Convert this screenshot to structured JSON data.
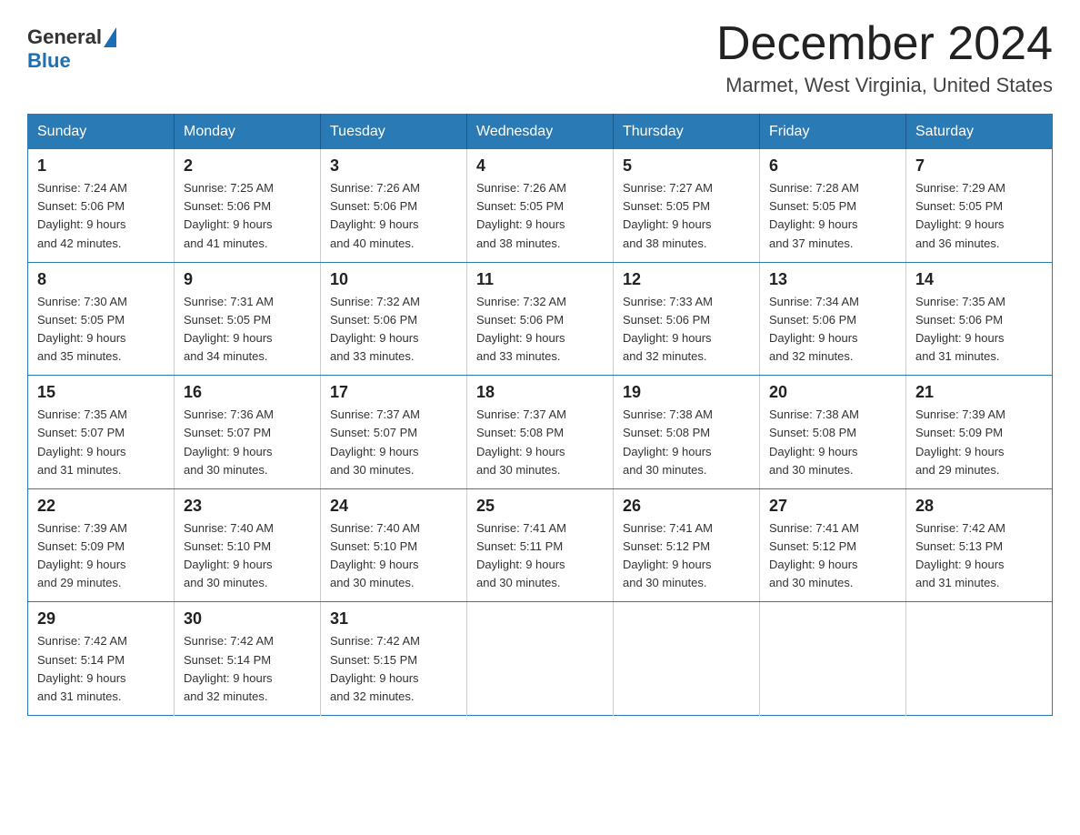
{
  "header": {
    "logo_general": "General",
    "logo_blue": "Blue",
    "month_title": "December 2024",
    "location": "Marmet, West Virginia, United States"
  },
  "days_of_week": [
    "Sunday",
    "Monday",
    "Tuesday",
    "Wednesday",
    "Thursday",
    "Friday",
    "Saturday"
  ],
  "weeks": [
    [
      {
        "day": "1",
        "sunrise": "7:24 AM",
        "sunset": "5:06 PM",
        "daylight": "9 hours and 42 minutes."
      },
      {
        "day": "2",
        "sunrise": "7:25 AM",
        "sunset": "5:06 PM",
        "daylight": "9 hours and 41 minutes."
      },
      {
        "day": "3",
        "sunrise": "7:26 AM",
        "sunset": "5:06 PM",
        "daylight": "9 hours and 40 minutes."
      },
      {
        "day": "4",
        "sunrise": "7:26 AM",
        "sunset": "5:05 PM",
        "daylight": "9 hours and 38 minutes."
      },
      {
        "day": "5",
        "sunrise": "7:27 AM",
        "sunset": "5:05 PM",
        "daylight": "9 hours and 38 minutes."
      },
      {
        "day": "6",
        "sunrise": "7:28 AM",
        "sunset": "5:05 PM",
        "daylight": "9 hours and 37 minutes."
      },
      {
        "day": "7",
        "sunrise": "7:29 AM",
        "sunset": "5:05 PM",
        "daylight": "9 hours and 36 minutes."
      }
    ],
    [
      {
        "day": "8",
        "sunrise": "7:30 AM",
        "sunset": "5:05 PM",
        "daylight": "9 hours and 35 minutes."
      },
      {
        "day": "9",
        "sunrise": "7:31 AM",
        "sunset": "5:05 PM",
        "daylight": "9 hours and 34 minutes."
      },
      {
        "day": "10",
        "sunrise": "7:32 AM",
        "sunset": "5:06 PM",
        "daylight": "9 hours and 33 minutes."
      },
      {
        "day": "11",
        "sunrise": "7:32 AM",
        "sunset": "5:06 PM",
        "daylight": "9 hours and 33 minutes."
      },
      {
        "day": "12",
        "sunrise": "7:33 AM",
        "sunset": "5:06 PM",
        "daylight": "9 hours and 32 minutes."
      },
      {
        "day": "13",
        "sunrise": "7:34 AM",
        "sunset": "5:06 PM",
        "daylight": "9 hours and 32 minutes."
      },
      {
        "day": "14",
        "sunrise": "7:35 AM",
        "sunset": "5:06 PM",
        "daylight": "9 hours and 31 minutes."
      }
    ],
    [
      {
        "day": "15",
        "sunrise": "7:35 AM",
        "sunset": "5:07 PM",
        "daylight": "9 hours and 31 minutes."
      },
      {
        "day": "16",
        "sunrise": "7:36 AM",
        "sunset": "5:07 PM",
        "daylight": "9 hours and 30 minutes."
      },
      {
        "day": "17",
        "sunrise": "7:37 AM",
        "sunset": "5:07 PM",
        "daylight": "9 hours and 30 minutes."
      },
      {
        "day": "18",
        "sunrise": "7:37 AM",
        "sunset": "5:08 PM",
        "daylight": "9 hours and 30 minutes."
      },
      {
        "day": "19",
        "sunrise": "7:38 AM",
        "sunset": "5:08 PM",
        "daylight": "9 hours and 30 minutes."
      },
      {
        "day": "20",
        "sunrise": "7:38 AM",
        "sunset": "5:08 PM",
        "daylight": "9 hours and 30 minutes."
      },
      {
        "day": "21",
        "sunrise": "7:39 AM",
        "sunset": "5:09 PM",
        "daylight": "9 hours and 29 minutes."
      }
    ],
    [
      {
        "day": "22",
        "sunrise": "7:39 AM",
        "sunset": "5:09 PM",
        "daylight": "9 hours and 29 minutes."
      },
      {
        "day": "23",
        "sunrise": "7:40 AM",
        "sunset": "5:10 PM",
        "daylight": "9 hours and 30 minutes."
      },
      {
        "day": "24",
        "sunrise": "7:40 AM",
        "sunset": "5:10 PM",
        "daylight": "9 hours and 30 minutes."
      },
      {
        "day": "25",
        "sunrise": "7:41 AM",
        "sunset": "5:11 PM",
        "daylight": "9 hours and 30 minutes."
      },
      {
        "day": "26",
        "sunrise": "7:41 AM",
        "sunset": "5:12 PM",
        "daylight": "9 hours and 30 minutes."
      },
      {
        "day": "27",
        "sunrise": "7:41 AM",
        "sunset": "5:12 PM",
        "daylight": "9 hours and 30 minutes."
      },
      {
        "day": "28",
        "sunrise": "7:42 AM",
        "sunset": "5:13 PM",
        "daylight": "9 hours and 31 minutes."
      }
    ],
    [
      {
        "day": "29",
        "sunrise": "7:42 AM",
        "sunset": "5:14 PM",
        "daylight": "9 hours and 31 minutes."
      },
      {
        "day": "30",
        "sunrise": "7:42 AM",
        "sunset": "5:14 PM",
        "daylight": "9 hours and 32 minutes."
      },
      {
        "day": "31",
        "sunrise": "7:42 AM",
        "sunset": "5:15 PM",
        "daylight": "9 hours and 32 minutes."
      },
      null,
      null,
      null,
      null
    ]
  ],
  "labels": {
    "sunrise_label": "Sunrise:",
    "sunset_label": "Sunset:",
    "daylight_label": "Daylight:"
  }
}
